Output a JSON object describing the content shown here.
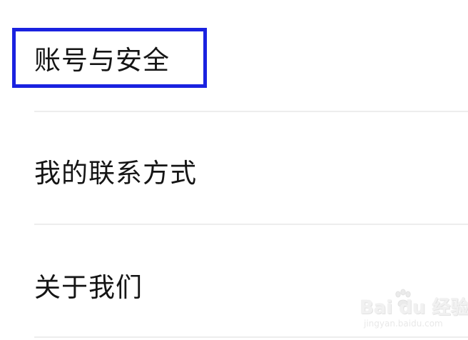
{
  "settings": {
    "items": [
      {
        "label": "账号与安全"
      },
      {
        "label": "我的联系方式"
      },
      {
        "label": "关于我们"
      }
    ]
  },
  "highlight": {
    "color": "#1a22e0"
  },
  "watermark": {
    "text": "Bai du 经验",
    "subtext": "jingyan.baidu.com"
  }
}
